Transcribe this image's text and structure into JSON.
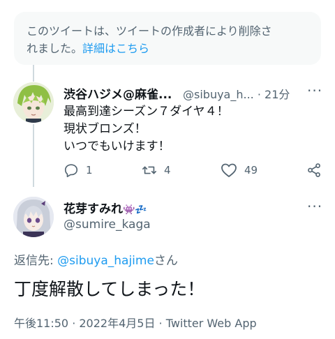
{
  "deleted_notice": {
    "text_line1": "このツイートは、ツイートの作成者により削除さ",
    "text_line2": "れました。",
    "link": "詳細はこちら"
  },
  "tweet1": {
    "display_name": "渋谷ハジメ@麻雀...",
    "handle": "@sibuya_h...",
    "time": "· 21分",
    "more": "···",
    "lines": [
      "最高到達シーズン７ダイヤ４！",
      "現状ブロンズ！",
      "いつでもいけます！"
    ],
    "replies": "1",
    "retweets": "4",
    "likes": "49"
  },
  "tweet2": {
    "display_name": "花芽すみれ",
    "display_name_emoji": "👾💤",
    "handle": "@sumire_kaga",
    "more": "···",
    "reply_prefix": "返信先: ",
    "reply_mention": "@sibuya_hajime",
    "reply_suffix": "さん",
    "text": "丁度解散してしまった！",
    "meta": "午後11:50 · 2022年4月5日 · Twitter Web App"
  },
  "colors": {
    "accent": "#1d9bf0",
    "secondary_text": "#536471",
    "notice_bg": "#f7f9f9"
  }
}
